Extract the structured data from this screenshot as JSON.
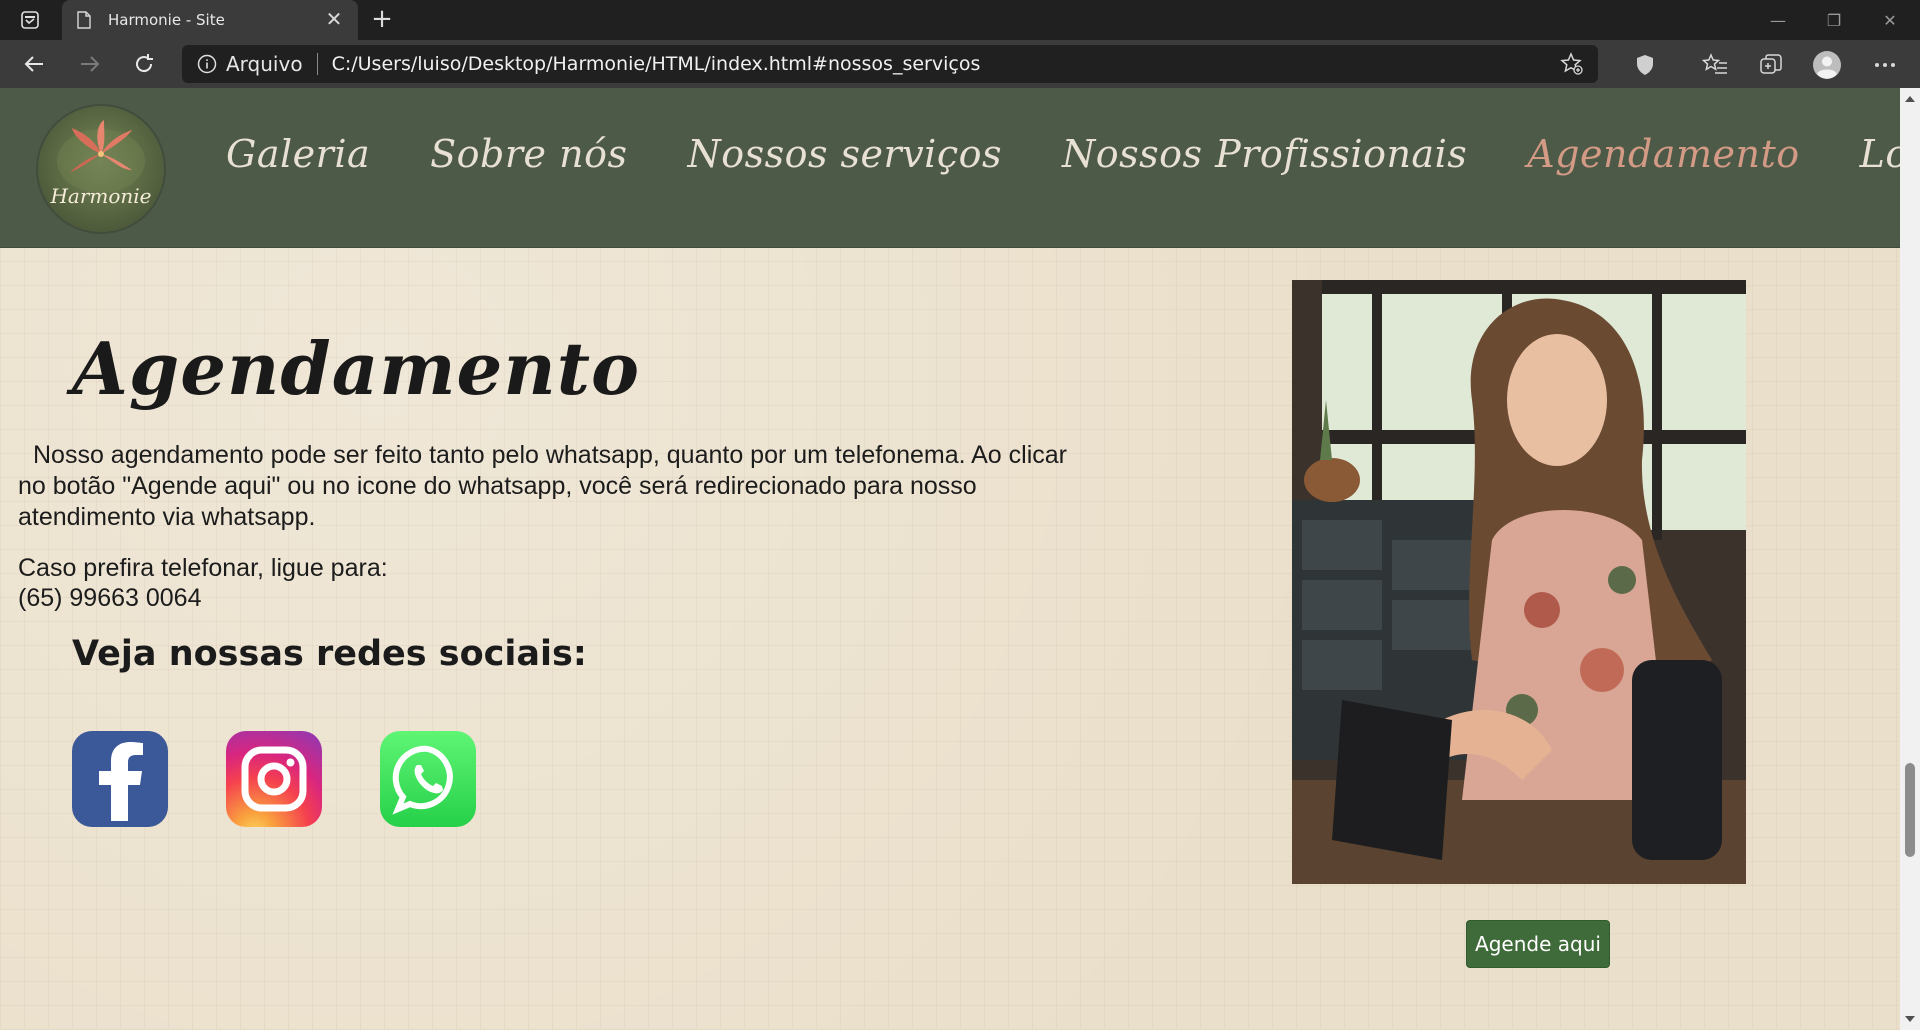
{
  "browser": {
    "tab_title": "Harmonie - Site",
    "tab_close": "✕",
    "new_tab": "+",
    "site_info_label": "Arquivo",
    "url": "C:/Users/luiso/Desktop/Harmonie/HTML/index.html#nossos_serviços",
    "window_controls": {
      "minimize": "—",
      "restore": "❐",
      "close": "✕"
    }
  },
  "site": {
    "logo_text": "Harmonie",
    "nav": [
      {
        "label": "Galeria"
      },
      {
        "label": "Sobre nós"
      },
      {
        "label": "Nossos serviços"
      },
      {
        "label": "Nossos Profissionais"
      },
      {
        "label": "Agendamento",
        "active": true
      },
      {
        "label": "Localização"
      }
    ],
    "section": {
      "title": "Agendamento",
      "paragraph1": "Nosso agendamento pode ser feito tanto pelo whatsapp, quanto por um telefonema. Ao clicar no botão \"Agende aqui\" ou no icone do whatsapp, você será redirecionado para nosso atendimento via whatsapp.",
      "paragraph2": "Caso prefira telefonar, ligue para:",
      "phone": "(65) 99663 0064",
      "social_title": "Veja nossas redes sociais:",
      "cta_button": "Agende aqui"
    }
  },
  "colors": {
    "header_bg": "#4d5a48",
    "nav_text": "#e8e1d3",
    "nav_active": "#d39a85",
    "page_bg": "#eadfca",
    "cta_bg": "#3f6a3a"
  },
  "icons": [
    "tab-actions-icon",
    "page-icon",
    "back-icon",
    "forward-icon",
    "refresh-icon",
    "info-icon",
    "add-favorite-icon",
    "shield-icon",
    "favorites-icon",
    "collections-icon",
    "profile-icon",
    "more-icon",
    "facebook-icon",
    "instagram-icon",
    "whatsapp-icon"
  ]
}
